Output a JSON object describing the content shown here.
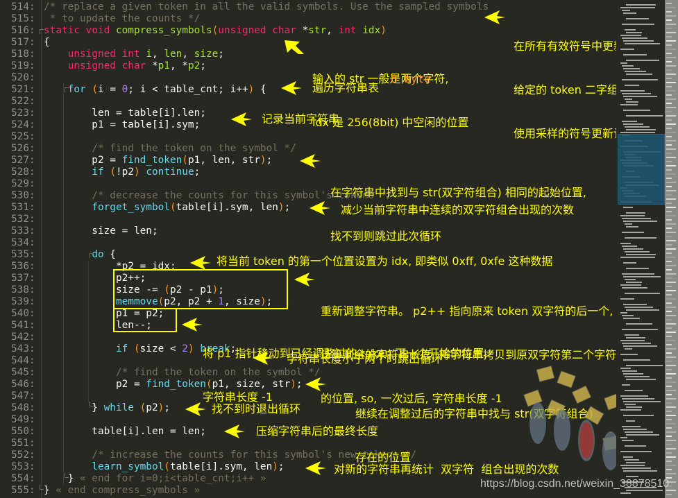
{
  "editor": {
    "lines": [
      {
        "no": "514:",
        "tokens": [
          {
            "t": "/* replace a given token in all the valid symbols. Use the sampled symbols",
            "c": "cm"
          }
        ]
      },
      {
        "no": "515:",
        "tokens": [
          {
            "t": " * to update the counts */",
            "c": "cm"
          }
        ]
      },
      {
        "no": "516:",
        "tokens": [
          {
            "t": "static",
            "c": "kw"
          },
          {
            "t": " "
          },
          {
            "t": "void",
            "c": "kw"
          },
          {
            "t": " "
          },
          {
            "t": "compress_symbols",
            "c": "fn"
          },
          {
            "t": "(",
            "c": "paren"
          },
          {
            "t": "unsigned",
            "c": "kw"
          },
          {
            "t": " "
          },
          {
            "t": "char",
            "c": "kw"
          },
          {
            "t": " *"
          },
          {
            "t": "str",
            "c": "fn"
          },
          {
            "t": ", "
          },
          {
            "t": "int",
            "c": "kw"
          },
          {
            "t": " "
          },
          {
            "t": "idx",
            "c": "fn"
          },
          {
            "t": ")",
            "c": "paren"
          }
        ]
      },
      {
        "no": "517:",
        "tokens": [
          {
            "t": "{"
          }
        ]
      },
      {
        "no": "518:",
        "tokens": [
          {
            "t": "    "
          },
          {
            "t": "unsigned",
            "c": "kw"
          },
          {
            "t": " "
          },
          {
            "t": "int",
            "c": "kw"
          },
          {
            "t": " "
          },
          {
            "t": "i",
            "c": "fn"
          },
          {
            "t": ", "
          },
          {
            "t": "len",
            "c": "fn"
          },
          {
            "t": ", "
          },
          {
            "t": "size",
            "c": "fn"
          },
          {
            "t": ";"
          }
        ]
      },
      {
        "no": "519:",
        "tokens": [
          {
            "t": "    "
          },
          {
            "t": "unsigned",
            "c": "kw"
          },
          {
            "t": " "
          },
          {
            "t": "char",
            "c": "kw"
          },
          {
            "t": " *"
          },
          {
            "t": "p1",
            "c": "fn"
          },
          {
            "t": ", *"
          },
          {
            "t": "p2",
            "c": "fn"
          },
          {
            "t": ";"
          }
        ]
      },
      {
        "no": "520:",
        "tokens": []
      },
      {
        "no": "521:",
        "tokens": [
          {
            "t": "    "
          },
          {
            "t": "for",
            "c": "bi"
          },
          {
            "t": " "
          },
          {
            "t": "(",
            "c": "paren"
          },
          {
            "t": "i = "
          },
          {
            "t": "0",
            "c": "num"
          },
          {
            "t": "; i < table_cnt; i++"
          },
          {
            "t": ")",
            "c": "paren"
          },
          {
            "t": " {"
          }
        ]
      },
      {
        "no": "522:",
        "tokens": []
      },
      {
        "no": "523:",
        "tokens": [
          {
            "t": "        len = table[i].len;"
          }
        ]
      },
      {
        "no": "524:",
        "tokens": [
          {
            "t": "        p1 = table[i].sym;"
          }
        ]
      },
      {
        "no": "525:",
        "tokens": []
      },
      {
        "no": "526:",
        "tokens": [
          {
            "t": "        "
          },
          {
            "t": "/* find the token on the symbol */",
            "c": "cm"
          }
        ]
      },
      {
        "no": "527:",
        "tokens": [
          {
            "t": "        p2 = "
          },
          {
            "t": "find_token",
            "c": "bi"
          },
          {
            "t": "(",
            "c": "paren"
          },
          {
            "t": "p1, len, str"
          },
          {
            "t": ")",
            "c": "paren"
          },
          {
            "t": ";"
          }
        ]
      },
      {
        "no": "528:",
        "tokens": [
          {
            "t": "        "
          },
          {
            "t": "if",
            "c": "bi"
          },
          {
            "t": " "
          },
          {
            "t": "(",
            "c": "paren"
          },
          {
            "t": "!p2"
          },
          {
            "t": ")",
            "c": "paren"
          },
          {
            "t": " "
          },
          {
            "t": "continue",
            "c": "bi"
          },
          {
            "t": ";"
          }
        ]
      },
      {
        "no": "529:",
        "tokens": []
      },
      {
        "no": "530:",
        "tokens": [
          {
            "t": "        "
          },
          {
            "t": "/* decrease the counts for this symbol's tokens */",
            "c": "cm"
          }
        ]
      },
      {
        "no": "531:",
        "tokens": [
          {
            "t": "        "
          },
          {
            "t": "forget_symbol",
            "c": "bi"
          },
          {
            "t": "(",
            "c": "paren"
          },
          {
            "t": "table[i].sym, len"
          },
          {
            "t": ")",
            "c": "paren"
          },
          {
            "t": ";"
          }
        ]
      },
      {
        "no": "532:",
        "tokens": []
      },
      {
        "no": "533:",
        "tokens": [
          {
            "t": "        size = len;"
          }
        ]
      },
      {
        "no": "534:",
        "tokens": []
      },
      {
        "no": "535:",
        "tokens": [
          {
            "t": "        "
          },
          {
            "t": "do",
            "c": "bi"
          },
          {
            "t": " {"
          }
        ]
      },
      {
        "no": "536:",
        "tokens": [
          {
            "t": "            *p2 = idx;"
          }
        ]
      },
      {
        "no": "537:",
        "tokens": [
          {
            "t": "            p2++;"
          }
        ]
      },
      {
        "no": "538:",
        "tokens": [
          {
            "t": "            size -= "
          },
          {
            "t": "(",
            "c": "paren"
          },
          {
            "t": "p2 - p1"
          },
          {
            "t": ")",
            "c": "paren"
          },
          {
            "t": ";"
          }
        ]
      },
      {
        "no": "539:",
        "tokens": [
          {
            "t": "            "
          },
          {
            "t": "memmove",
            "c": "bi"
          },
          {
            "t": "(",
            "c": "paren"
          },
          {
            "t": "p2, p2 + "
          },
          {
            "t": "1",
            "c": "num"
          },
          {
            "t": ", size"
          },
          {
            "t": ")",
            "c": "paren"
          },
          {
            "t": ";"
          }
        ]
      },
      {
        "no": "540:",
        "tokens": [
          {
            "t": "            p1 = p2;"
          }
        ]
      },
      {
        "no": "541:",
        "tokens": [
          {
            "t": "            len--;"
          }
        ]
      },
      {
        "no": "542:",
        "tokens": []
      },
      {
        "no": "543:",
        "tokens": [
          {
            "t": "            "
          },
          {
            "t": "if",
            "c": "bi"
          },
          {
            "t": " "
          },
          {
            "t": "(",
            "c": "paren"
          },
          {
            "t": "size < "
          },
          {
            "t": "2",
            "c": "num"
          },
          {
            "t": ")",
            "c": "paren"
          },
          {
            "t": " "
          },
          {
            "t": "break",
            "c": "bi"
          },
          {
            "t": ";"
          }
        ]
      },
      {
        "no": "544:",
        "tokens": []
      },
      {
        "no": "545:",
        "tokens": [
          {
            "t": "            "
          },
          {
            "t": "/* find the token on the symbol */",
            "c": "cm"
          }
        ]
      },
      {
        "no": "546:",
        "tokens": [
          {
            "t": "            p2 = "
          },
          {
            "t": "find_token",
            "c": "bi"
          },
          {
            "t": "(",
            "c": "paren"
          },
          {
            "t": "p1, size, str"
          },
          {
            "t": ")",
            "c": "paren"
          },
          {
            "t": ";"
          }
        ]
      },
      {
        "no": "547:",
        "tokens": []
      },
      {
        "no": "548:",
        "tokens": [
          {
            "t": "        } "
          },
          {
            "t": "while",
            "c": "bi"
          },
          {
            "t": " "
          },
          {
            "t": "(",
            "c": "paren"
          },
          {
            "t": "p2"
          },
          {
            "t": ")",
            "c": "paren"
          },
          {
            "t": ";"
          }
        ]
      },
      {
        "no": "549:",
        "tokens": []
      },
      {
        "no": "550:",
        "tokens": [
          {
            "t": "        table[i].len = len;"
          }
        ]
      },
      {
        "no": "551:",
        "tokens": []
      },
      {
        "no": "552:",
        "tokens": [
          {
            "t": "        "
          },
          {
            "t": "/* increase the counts for this symbol's new tokens */",
            "c": "cm"
          }
        ]
      },
      {
        "no": "553:",
        "tokens": [
          {
            "t": "        "
          },
          {
            "t": "learn_symbol",
            "c": "bi"
          },
          {
            "t": "(",
            "c": "paren"
          },
          {
            "t": "table[i].sym, len"
          },
          {
            "t": ")",
            "c": "paren"
          },
          {
            "t": ";"
          }
        ]
      },
      {
        "no": "554:",
        "tokens": [
          {
            "t": "    } "
          },
          {
            "t": "« end for i=0;i<table_cnt;i++ »",
            "c": "cm"
          }
        ]
      },
      {
        "no": "555:",
        "tokens": [
          {
            "t": "} "
          },
          {
            "t": "« end compress_symbols »",
            "c": "cm"
          }
        ]
      }
    ]
  },
  "annotations": {
    "header": [
      "在所有有效符号中更新",
      "给定的 token 二字组。",
      "使用采样的符号更新计数"
    ],
    "params": [
      "输入的 str 一般是两个字符,",
      "idx 是 256(8bit) 中空闲的位置"
    ],
    "params_extra": "8 byte",
    "loop": "遍历字符串表",
    "record": "记录当前字符串",
    "find": [
      "在字符串中找到与 str(双字符组合) 相同的起始位置,",
      "找不到则跳过此次循环"
    ],
    "forget": "减少当前字符串中连续的双字符组合出现的次数",
    "set_idx": "将当前 token 的第一个位置设置为 idx, 即类似 0xff, 0xfe 这种数据",
    "adjust": [
      "重新调整字符串。 p2++ 指向原来 token 双字符的后一个,",
      "计算剩余的字符串长度, 将字符串拷贝到原双字符第二个字符",
      "的位置, so, 一次过后, 字符串长度 -1"
    ],
    "move_p1": [
      "将 p1 指针移动到已经调整过的 token 下一个开始的位置,",
      "字符串长度 -1"
    ],
    "break": "字符串长度小于两个时跳出循环",
    "refind": [
      "继续在调整过后的字符串中找与 str(双字符组合)",
      "存在的位置"
    ],
    "while": "找不到时退出循环",
    "final_len": "压缩字符串后的最终长度",
    "learn": "对新的字符串再统计  双字符  组合出现的次数"
  },
  "watermark": "https://blog.csdn.net/weixin_38878510",
  "colors": {
    "background": "#272822",
    "keyword": "#f92672",
    "function": "#a6e22e",
    "builtin": "#66d9ef",
    "number": "#ae81ff",
    "comment": "#75715e",
    "annotation": "#ffff00"
  }
}
